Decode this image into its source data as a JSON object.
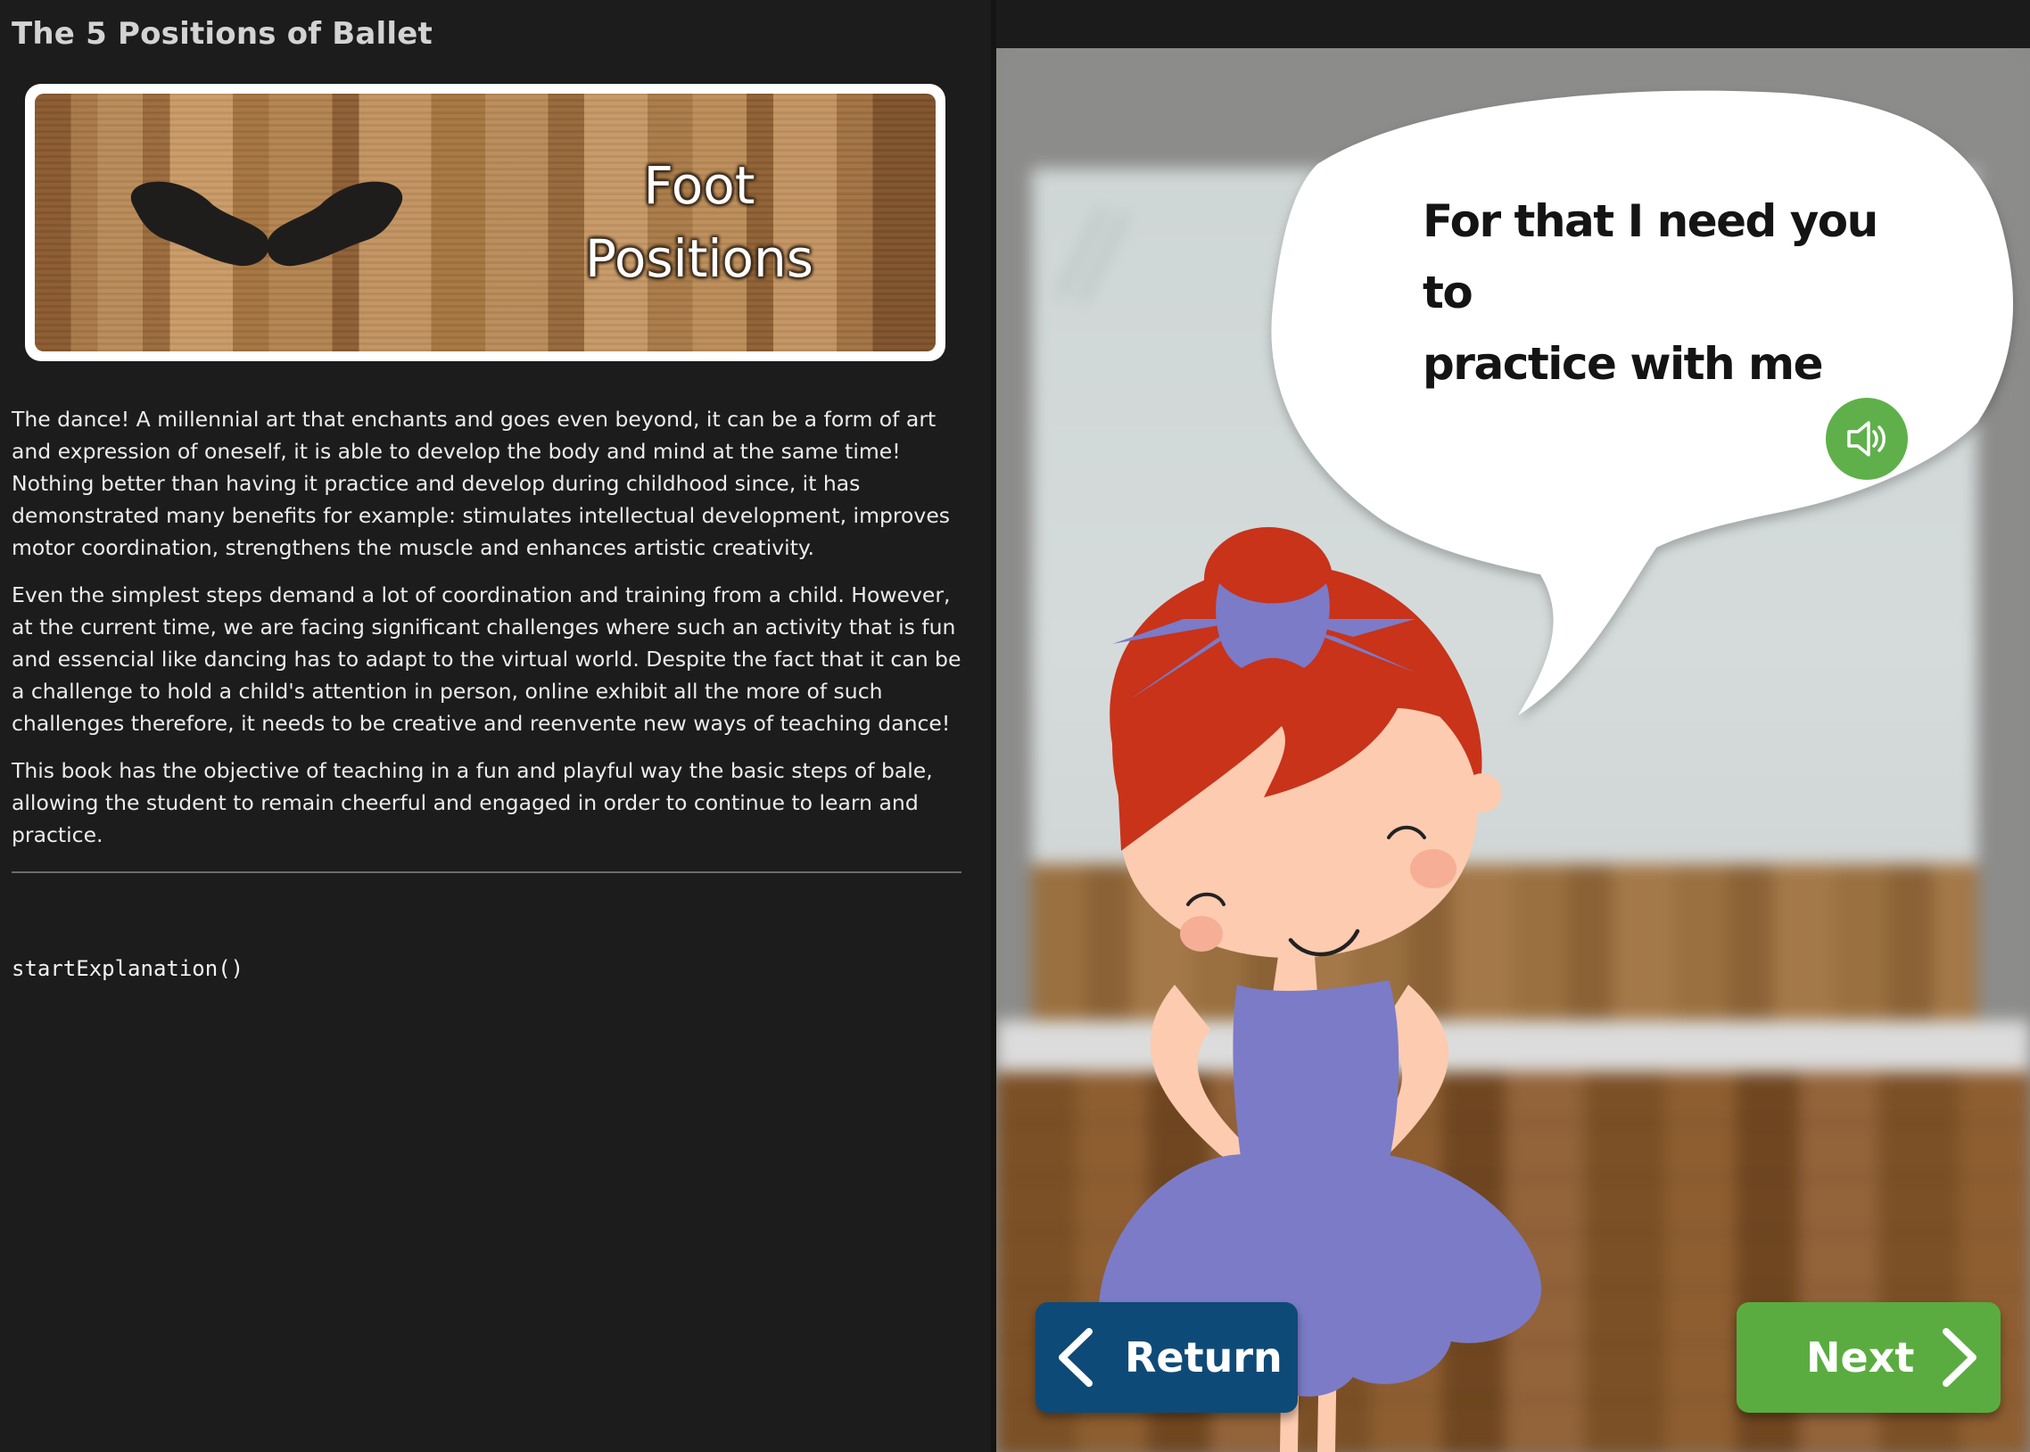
{
  "page": {
    "title": "The 5 Positions of Ballet"
  },
  "banner": {
    "line1": "Foot",
    "line2": "Positions"
  },
  "intro": {
    "paragraphs": [
      "The dance! A millennial art that enchants and goes even beyond, it can be a form of art and expression of oneself, it is able to develop the body and mind at the same time! Nothing better than having it practice and develop during childhood since, it has demonstrated many benefits for example: stimulates intellectual development, improves motor coordination, strengthens the muscle and enhances artistic creativity.",
      "Even the simplest steps demand a lot of coordination and training from a child. However, at the current time, we are facing significant challenges where such an activity that is fun and essencial like dancing has to adapt to the virtual world. Despite the fact that it can be a challenge to hold a child's attention in person, online exhibit all the more of such challenges therefore, it needs to be creative and reenvente new ways of teaching dance!",
      "This book has the objective of teaching in a fun and playful way the basic steps of bale, allowing the student to remain cheerful and engaged in order to continue to learn and practice."
    ]
  },
  "code": {
    "call": "startExplanation()"
  },
  "story": {
    "speech_line1": "For that I need you to",
    "speech_line2": "practice with me",
    "sound_icon": "speaker-icon",
    "return_label": "Return",
    "next_label": "Next"
  },
  "colors": {
    "background": "#1c1c1c",
    "return_button": "#0e4a77",
    "next_button": "#5aac40",
    "sound_button": "#5fb04a",
    "hair": "#c8331a",
    "dress": "#7b7bc8",
    "skin": "#fccbb0"
  }
}
